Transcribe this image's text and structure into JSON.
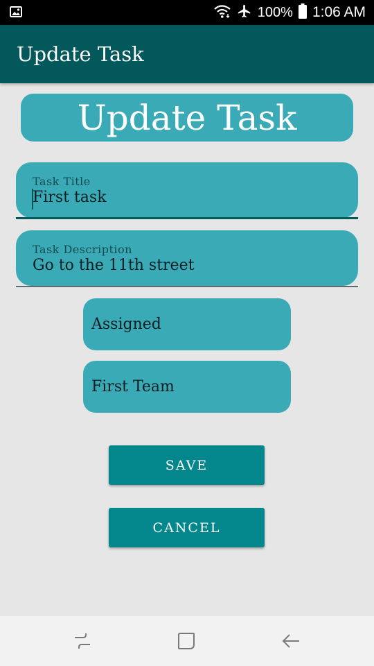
{
  "status_bar": {
    "battery": "100%",
    "time": "1:06 AM",
    "icons": [
      "image-icon",
      "wifi-icon",
      "airplane-icon",
      "battery-icon"
    ]
  },
  "app_bar": {
    "title": "Update Task"
  },
  "header": {
    "title": "Update Task"
  },
  "form": {
    "task_title": {
      "label": "Task Title",
      "value": "First task"
    },
    "task_description": {
      "label": "Task Description",
      "value": "Go to the 11th street"
    },
    "status_select": {
      "value": "Assigned"
    },
    "team_select": {
      "value": "First Team"
    }
  },
  "buttons": {
    "save": "SAVE",
    "cancel": "CANCEL"
  },
  "nav_bar": {
    "icons": [
      "recent-apps-icon",
      "home-icon",
      "back-icon"
    ]
  },
  "colors": {
    "app_bar": "#03585c",
    "field_bg": "#3aabb6",
    "button_bg": "#04878c",
    "background": "#e6e6e6"
  }
}
